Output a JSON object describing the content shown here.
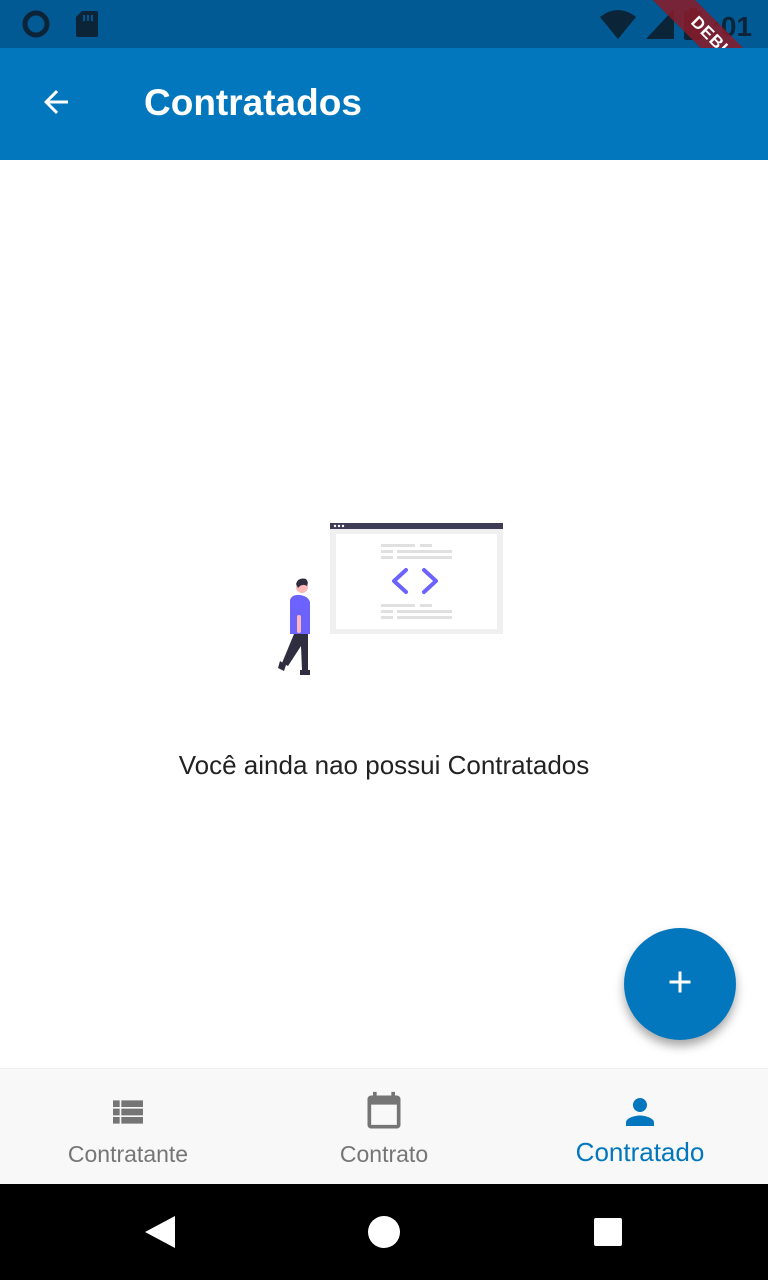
{
  "status_bar": {
    "time": ":01",
    "debug_banner": "DEBUG",
    "icons": [
      "circle-notification-icon",
      "sd-card-icon",
      "wifi-icon",
      "cell-signal-icon",
      "battery-icon"
    ]
  },
  "app_bar": {
    "title": "Contratados",
    "back_icon": "arrow-back-icon"
  },
  "empty_state": {
    "message": "Você ainda nao possui Contratados",
    "illustration": "person-walking-to-code-window"
  },
  "fab": {
    "icon": "plus-icon"
  },
  "bottom_nav": {
    "items": [
      {
        "label": "Contratante",
        "icon": "list-icon",
        "active": false
      },
      {
        "label": "Contrato",
        "icon": "calendar-icon",
        "active": false
      },
      {
        "label": "Contratado",
        "icon": "person-icon",
        "active": true
      }
    ]
  },
  "system_nav": {
    "icons": [
      "back-triangle-icon",
      "home-circle-icon",
      "recents-square-icon"
    ]
  },
  "colors": {
    "status_bar": "#015a93",
    "app_bar": "#0277bd",
    "accent": "#0277bd",
    "nav_inactive": "#757575",
    "illustration_purple": "#6c63ff"
  }
}
